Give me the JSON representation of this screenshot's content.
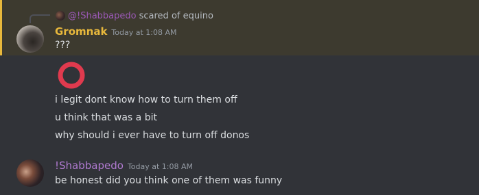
{
  "reply": {
    "username": "@!Shabbapedo",
    "text": "scared of equino"
  },
  "messages": [
    {
      "username": "Gromnak",
      "timestamp": "Today at 1:08 AM",
      "name_color": "#e8b83c",
      "lines": [
        "???"
      ]
    },
    {
      "lines": [
        "i legit dont know how to turn them off",
        "u think that was a bit",
        "why should i ever have to turn off donos"
      ],
      "emoji": "red-ring-icon"
    },
    {
      "username": "!Shabbapedo",
      "timestamp": "Today at 1:08 AM",
      "name_color": "#b07ad0",
      "lines": [
        "be honest did you think one of them was funny"
      ]
    }
  ],
  "colors": {
    "background": "#313338",
    "highlight": "#3d3a2f",
    "highlight_bar": "#e8b83c",
    "emoji_red": "#e03a4e"
  }
}
